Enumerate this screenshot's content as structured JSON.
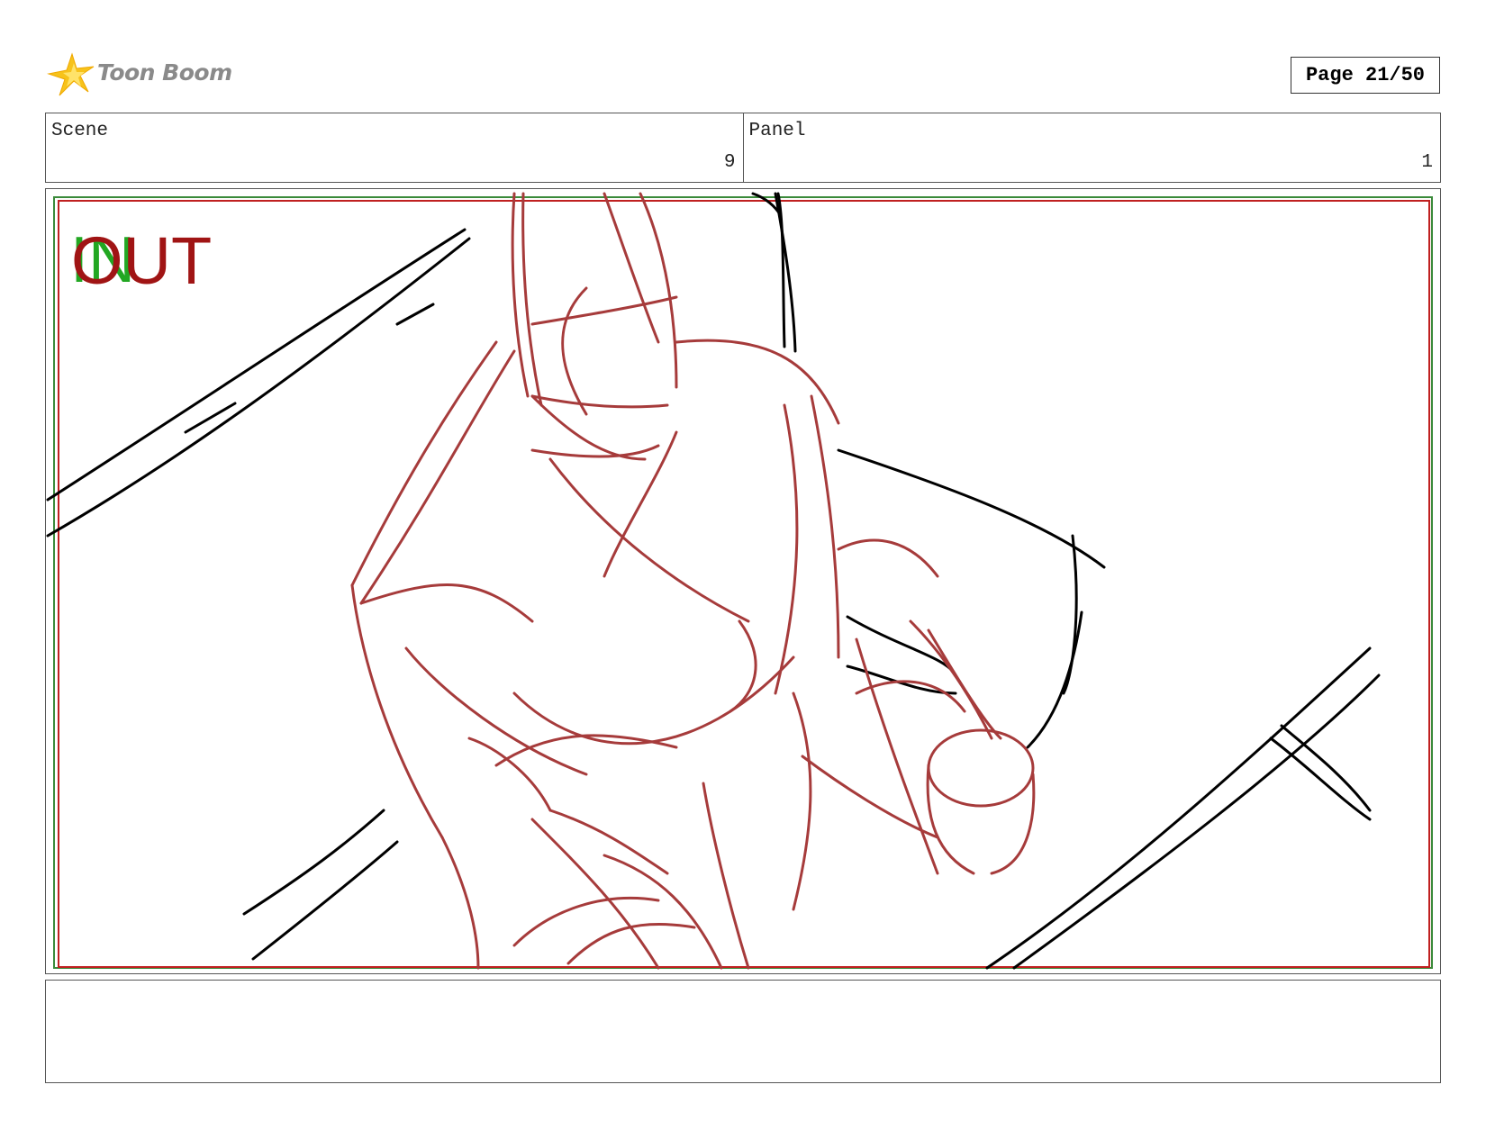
{
  "header": {
    "logo_text": "Toon Boom",
    "page_label": "Page 21/50"
  },
  "info": {
    "scene_label": "Scene",
    "scene_value": "9",
    "panel_label": "Panel",
    "panel_value": "1"
  },
  "panel": {
    "in_marker": "IN",
    "out_marker": "OUT",
    "colors": {
      "in_marker": "#22a722",
      "out_marker": "#a01414",
      "sketch_red": "#a63b3b",
      "sketch_black": "#000000",
      "safe_frame_green": "#3a8a3a",
      "safe_frame_red": "#c02020"
    }
  },
  "notes": {
    "text": ""
  }
}
